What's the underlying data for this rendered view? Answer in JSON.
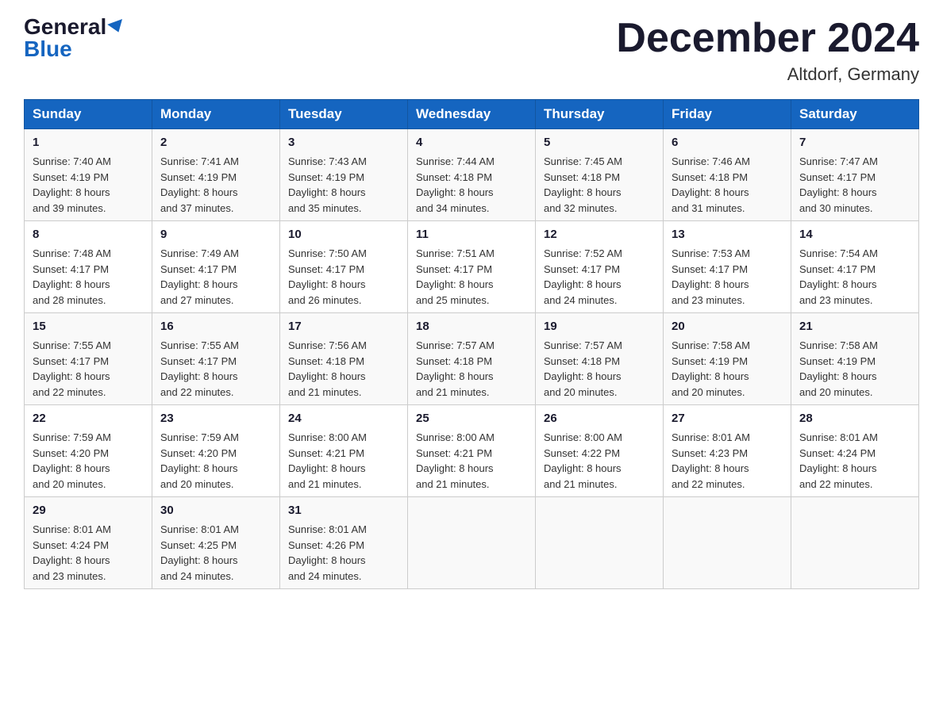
{
  "header": {
    "logo_general": "General",
    "logo_blue": "Blue",
    "title": "December 2024",
    "subtitle": "Altdorf, Germany"
  },
  "weekdays": [
    "Sunday",
    "Monday",
    "Tuesday",
    "Wednesday",
    "Thursday",
    "Friday",
    "Saturday"
  ],
  "weeks": [
    [
      {
        "day": "1",
        "sunrise": "7:40 AM",
        "sunset": "4:19 PM",
        "daylight": "8 hours and 39 minutes."
      },
      {
        "day": "2",
        "sunrise": "7:41 AM",
        "sunset": "4:19 PM",
        "daylight": "8 hours and 37 minutes."
      },
      {
        "day": "3",
        "sunrise": "7:43 AM",
        "sunset": "4:19 PM",
        "daylight": "8 hours and 35 minutes."
      },
      {
        "day": "4",
        "sunrise": "7:44 AM",
        "sunset": "4:18 PM",
        "daylight": "8 hours and 34 minutes."
      },
      {
        "day": "5",
        "sunrise": "7:45 AM",
        "sunset": "4:18 PM",
        "daylight": "8 hours and 32 minutes."
      },
      {
        "day": "6",
        "sunrise": "7:46 AM",
        "sunset": "4:18 PM",
        "daylight": "8 hours and 31 minutes."
      },
      {
        "day": "7",
        "sunrise": "7:47 AM",
        "sunset": "4:17 PM",
        "daylight": "8 hours and 30 minutes."
      }
    ],
    [
      {
        "day": "8",
        "sunrise": "7:48 AM",
        "sunset": "4:17 PM",
        "daylight": "8 hours and 28 minutes."
      },
      {
        "day": "9",
        "sunrise": "7:49 AM",
        "sunset": "4:17 PM",
        "daylight": "8 hours and 27 minutes."
      },
      {
        "day": "10",
        "sunrise": "7:50 AM",
        "sunset": "4:17 PM",
        "daylight": "8 hours and 26 minutes."
      },
      {
        "day": "11",
        "sunrise": "7:51 AM",
        "sunset": "4:17 PM",
        "daylight": "8 hours and 25 minutes."
      },
      {
        "day": "12",
        "sunrise": "7:52 AM",
        "sunset": "4:17 PM",
        "daylight": "8 hours and 24 minutes."
      },
      {
        "day": "13",
        "sunrise": "7:53 AM",
        "sunset": "4:17 PM",
        "daylight": "8 hours and 23 minutes."
      },
      {
        "day": "14",
        "sunrise": "7:54 AM",
        "sunset": "4:17 PM",
        "daylight": "8 hours and 23 minutes."
      }
    ],
    [
      {
        "day": "15",
        "sunrise": "7:55 AM",
        "sunset": "4:17 PM",
        "daylight": "8 hours and 22 minutes."
      },
      {
        "day": "16",
        "sunrise": "7:55 AM",
        "sunset": "4:17 PM",
        "daylight": "8 hours and 22 minutes."
      },
      {
        "day": "17",
        "sunrise": "7:56 AM",
        "sunset": "4:18 PM",
        "daylight": "8 hours and 21 minutes."
      },
      {
        "day": "18",
        "sunrise": "7:57 AM",
        "sunset": "4:18 PM",
        "daylight": "8 hours and 21 minutes."
      },
      {
        "day": "19",
        "sunrise": "7:57 AM",
        "sunset": "4:18 PM",
        "daylight": "8 hours and 20 minutes."
      },
      {
        "day": "20",
        "sunrise": "7:58 AM",
        "sunset": "4:19 PM",
        "daylight": "8 hours and 20 minutes."
      },
      {
        "day": "21",
        "sunrise": "7:58 AM",
        "sunset": "4:19 PM",
        "daylight": "8 hours and 20 minutes."
      }
    ],
    [
      {
        "day": "22",
        "sunrise": "7:59 AM",
        "sunset": "4:20 PM",
        "daylight": "8 hours and 20 minutes."
      },
      {
        "day": "23",
        "sunrise": "7:59 AM",
        "sunset": "4:20 PM",
        "daylight": "8 hours and 20 minutes."
      },
      {
        "day": "24",
        "sunrise": "8:00 AM",
        "sunset": "4:21 PM",
        "daylight": "8 hours and 21 minutes."
      },
      {
        "day": "25",
        "sunrise": "8:00 AM",
        "sunset": "4:21 PM",
        "daylight": "8 hours and 21 minutes."
      },
      {
        "day": "26",
        "sunrise": "8:00 AM",
        "sunset": "4:22 PM",
        "daylight": "8 hours and 21 minutes."
      },
      {
        "day": "27",
        "sunrise": "8:01 AM",
        "sunset": "4:23 PM",
        "daylight": "8 hours and 22 minutes."
      },
      {
        "day": "28",
        "sunrise": "8:01 AM",
        "sunset": "4:24 PM",
        "daylight": "8 hours and 22 minutes."
      }
    ],
    [
      {
        "day": "29",
        "sunrise": "8:01 AM",
        "sunset": "4:24 PM",
        "daylight": "8 hours and 23 minutes."
      },
      {
        "day": "30",
        "sunrise": "8:01 AM",
        "sunset": "4:25 PM",
        "daylight": "8 hours and 24 minutes."
      },
      {
        "day": "31",
        "sunrise": "8:01 AM",
        "sunset": "4:26 PM",
        "daylight": "8 hours and 24 minutes."
      },
      null,
      null,
      null,
      null
    ]
  ],
  "labels": {
    "sunrise": "Sunrise:",
    "sunset": "Sunset:",
    "daylight": "Daylight:"
  }
}
